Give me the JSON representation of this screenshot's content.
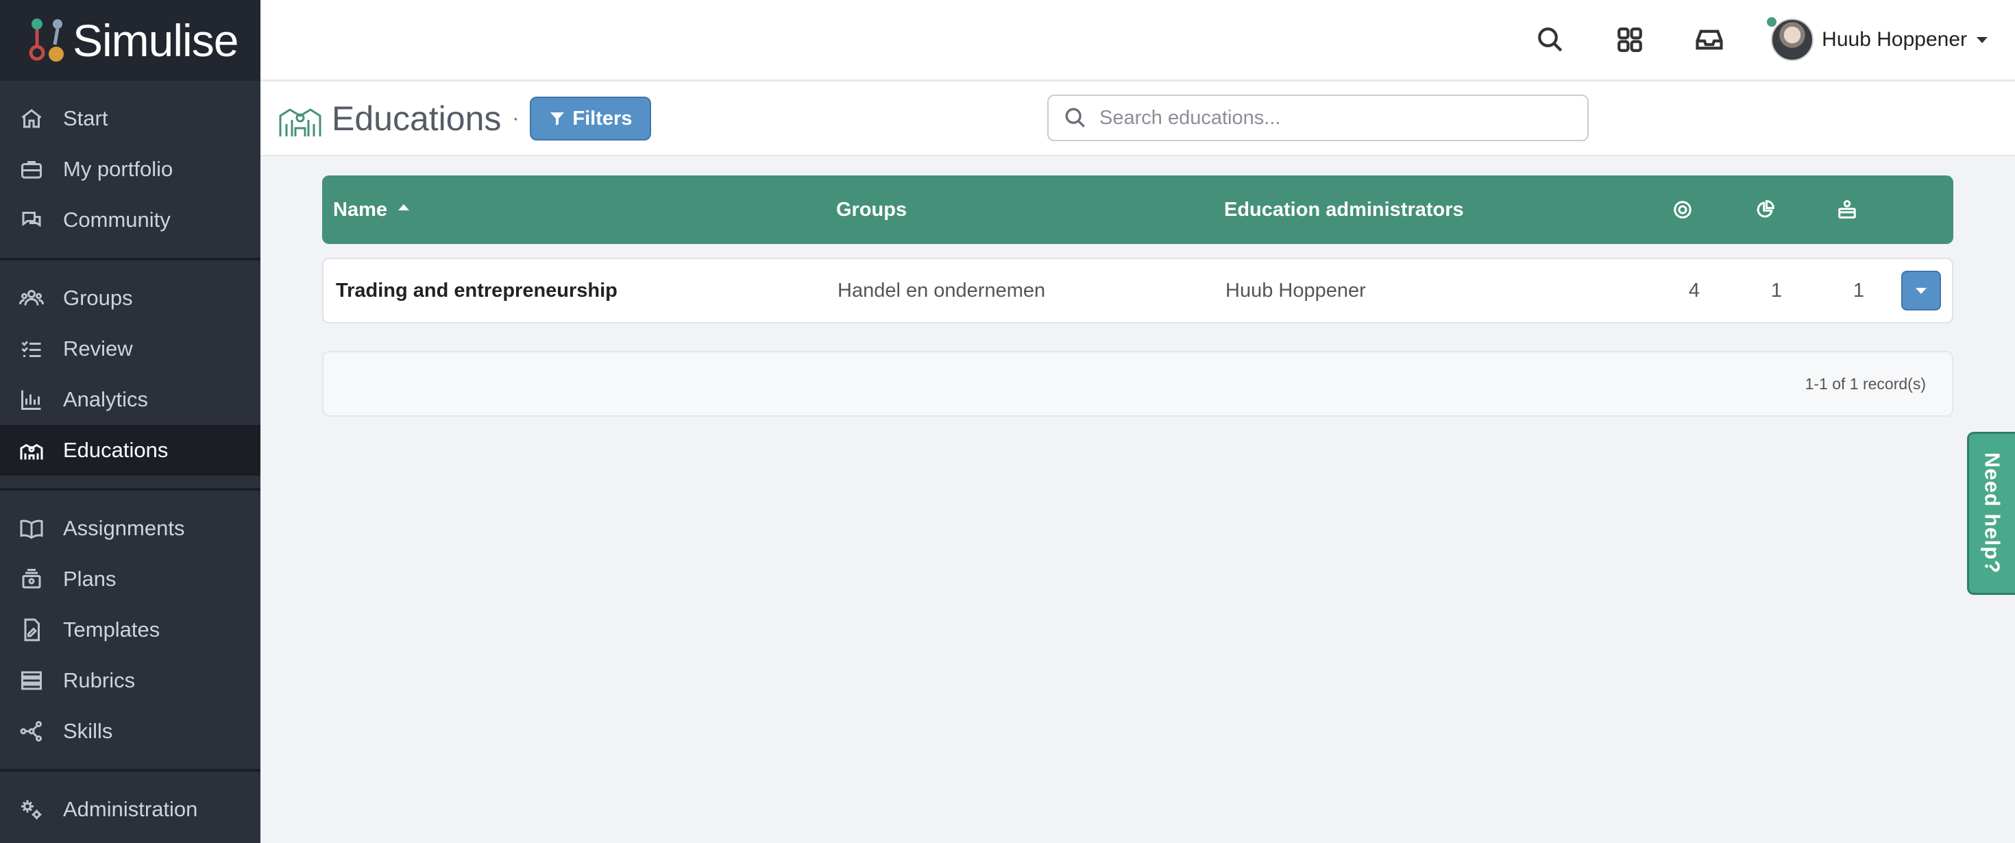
{
  "brand": {
    "name": "Simulise"
  },
  "sidebar": {
    "groups": [
      [
        {
          "label": "Start",
          "icon": "home-icon"
        },
        {
          "label": "My portfolio",
          "icon": "briefcase-icon"
        },
        {
          "label": "Community",
          "icon": "chat-icon"
        }
      ],
      [
        {
          "label": "Groups",
          "icon": "users-icon"
        },
        {
          "label": "Review",
          "icon": "checklist-icon"
        },
        {
          "label": "Analytics",
          "icon": "bar-chart-icon"
        },
        {
          "label": "Educations",
          "icon": "school-icon",
          "active": true
        }
      ],
      [
        {
          "label": "Assignments",
          "icon": "book-icon"
        },
        {
          "label": "Plans",
          "icon": "layers-icon"
        },
        {
          "label": "Templates",
          "icon": "file-icon"
        },
        {
          "label": "Rubrics",
          "icon": "rubric-icon"
        },
        {
          "label": "Skills",
          "icon": "network-icon"
        }
      ],
      [
        {
          "label": "Administration",
          "icon": "gears-icon"
        }
      ]
    ]
  },
  "topbar": {
    "user_name": "Huub Hoppener"
  },
  "header": {
    "title": "Educations",
    "separator": "·",
    "filters_label": "Filters",
    "search_placeholder": "Search educations..."
  },
  "table": {
    "columns": {
      "name": "Name",
      "groups": "Groups",
      "admins": "Education administrators"
    },
    "rows": [
      {
        "name": "Trading and entrepreneurship",
        "groups": "Handel en ondernemen",
        "admins": "Huub Hoppener",
        "c1": "4",
        "c2": "1",
        "c3": "1"
      }
    ],
    "footer": "1-1 of 1 record(s)"
  },
  "help": {
    "label": "Need help?"
  },
  "colors": {
    "accent_green": "#459079",
    "button_blue": "#5591c6",
    "sidebar_bg": "#2b303b"
  }
}
